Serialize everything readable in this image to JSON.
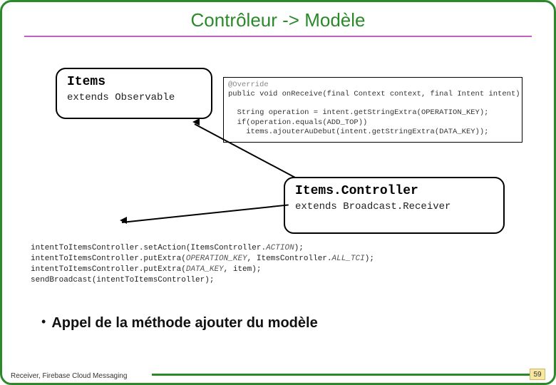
{
  "title": "Contrôleur -> Modèle",
  "items_box": {
    "title": "Items",
    "subtitle": "extends Observable"
  },
  "controller_box": {
    "title": "Items.Controller",
    "subtitle": "extends Broadcast.Receiver"
  },
  "override_code": {
    "l1": "@Override",
    "l2": "public void onReceive(final Context context, final Intent intent) {",
    "l3": "  String operation = intent.getStringExtra(OPERATION_KEY);",
    "l4": "  if(operation.equals(ADD_TOP))",
    "l5": "    items.ajouterAuDebut(intent.getStringExtra(DATA_KEY));"
  },
  "invoke_code": {
    "l1_a": "intentToItemsController.setAction(ItemsController.",
    "l1_b": "ACTION",
    "l1_c": ");",
    "l2_a": "intentToItemsController.putExtra(",
    "l2_b": "OPERATION_KEY",
    "l2_c": ", ItemsController.",
    "l2_d": "ALL_TCI",
    "l2_e": ");",
    "l3_a": "intentToItemsController.putExtra(",
    "l3_b": "DATA_KEY",
    "l3_c": ", item);",
    "l4": "sendBroadcast(intentToItemsController);"
  },
  "bullet": "Appel de la méthode ajouter du modèle",
  "footer_label": "Receiver, Firebase Cloud Messaging",
  "page_number": "59"
}
